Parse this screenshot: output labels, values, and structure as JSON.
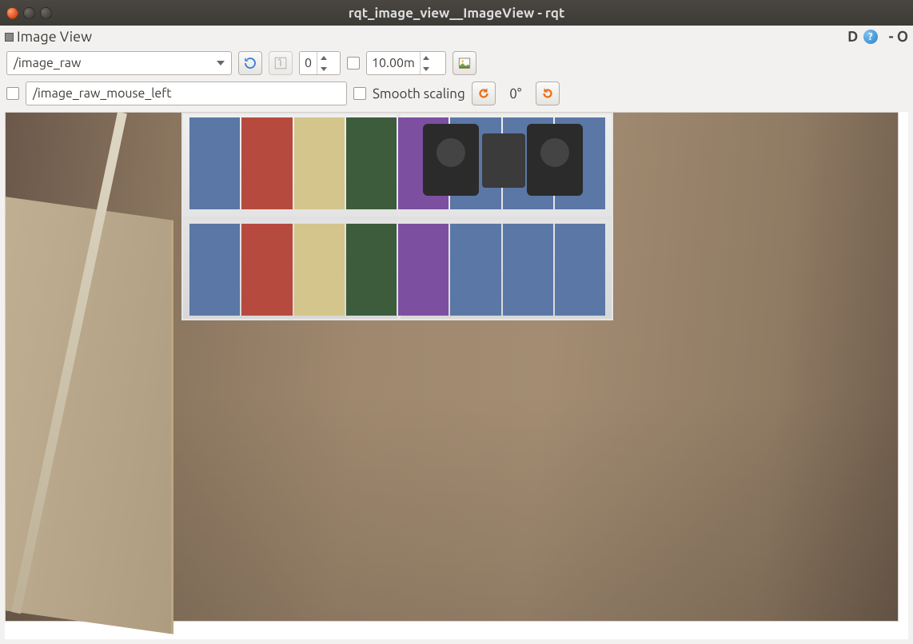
{
  "window": {
    "title": "rqt_image_view__ImageView - rqt"
  },
  "panel": {
    "title": "Image View",
    "detach_label": "D",
    "options_glyph": "- O"
  },
  "toolbar1": {
    "topic_combo_value": "/image_raw",
    "refresh_tooltip": "Refresh topics",
    "zoom1_tooltip": "Zoom 1:1",
    "num_value": "0",
    "max_hz_value": "10.00m",
    "save_tooltip": "Save image"
  },
  "toolbar2": {
    "mouse_topic": "/image_raw_mouse_left",
    "smooth_label": "Smooth scaling",
    "rotate_left_tooltip": "Rotate left",
    "rotation_label": "0°",
    "rotate_right_tooltip": "Rotate right"
  },
  "image": {
    "topic": "/image_raw",
    "description": "Camera feed showing a room with a white bookshelf containing books and stereo speakers, wooden floor, cardboard boxes and a metal rail in the foreground."
  }
}
